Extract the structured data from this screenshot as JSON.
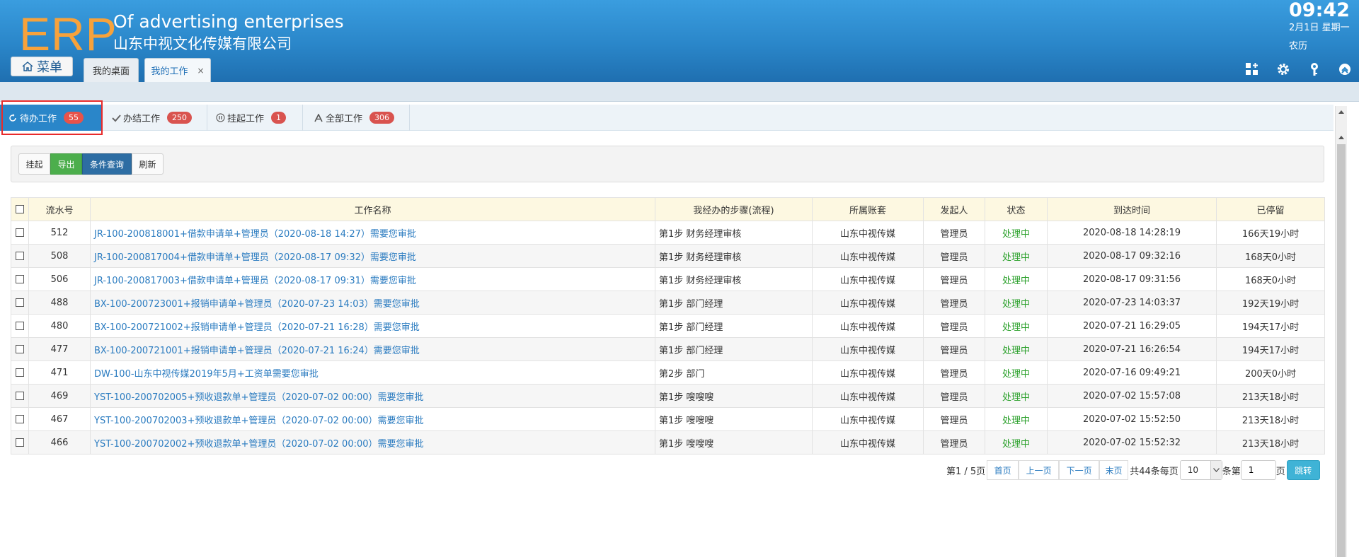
{
  "header": {
    "logo": "ERP",
    "company_en": "Of advertising enterprises",
    "company_cn": "山东中视文化传媒有限公司",
    "menu_label": "菜单",
    "tabs": [
      {
        "label": "我的桌面"
      },
      {
        "label": "我的工作",
        "close": "×"
      }
    ],
    "clock": "09:42",
    "date": "2月1日 星期一",
    "lunar": "农历",
    "icons": [
      "grid-add-icon",
      "gear-icon",
      "key-icon",
      "collapse-up-icon"
    ],
    "colors": {
      "brand_orange": "#f7a23b",
      "header_blue": "#2a86c9"
    }
  },
  "worktabs": [
    {
      "label": "待办工作",
      "count": "55",
      "icon": "refresh-icon"
    },
    {
      "label": "办结工作",
      "count": "250",
      "icon": "check-icon"
    },
    {
      "label": "挂起工作",
      "count": "1",
      "icon": "pause-icon"
    },
    {
      "label": "全部工作",
      "count": "306",
      "icon": "letter-a-icon"
    }
  ],
  "toolbar": {
    "hang": "挂起",
    "export": "导出",
    "query": "条件查询",
    "refresh": "刷新"
  },
  "table": {
    "columns": [
      "流水号",
      "工作名称",
      "我经办的步骤(流程)",
      "所属账套",
      "发起人",
      "状态",
      "到达时间",
      "已停留"
    ],
    "rows": [
      {
        "id": "512",
        "name": "JR-100-200818001+借款申请单+管理员（2020-08-18 14:27）需要您审批",
        "step": "第1步 财务经理审核",
        "account": "山东中视传媒",
        "initiator": "管理员",
        "status": "处理中",
        "arrive": "2020-08-18 14:28:19",
        "stay": "166天19小时"
      },
      {
        "id": "508",
        "name": "JR-100-200817004+借款申请单+管理员（2020-08-17 09:32）需要您审批",
        "step": "第1步 财务经理审核",
        "account": "山东中视传媒",
        "initiator": "管理员",
        "status": "处理中",
        "arrive": "2020-08-17 09:32:16",
        "stay": "168天0小时"
      },
      {
        "id": "506",
        "name": "JR-100-200817003+借款申请单+管理员（2020-08-17 09:31）需要您审批",
        "step": "第1步 财务经理审核",
        "account": "山东中视传媒",
        "initiator": "管理员",
        "status": "处理中",
        "arrive": "2020-08-17 09:31:56",
        "stay": "168天0小时"
      },
      {
        "id": "488",
        "name": "BX-100-200723001+报销申请单+管理员（2020-07-23 14:03）需要您审批",
        "step": "第1步 部门经理",
        "account": "山东中视传媒",
        "initiator": "管理员",
        "status": "处理中",
        "arrive": "2020-07-23 14:03:37",
        "stay": "192天19小时"
      },
      {
        "id": "480",
        "name": "BX-100-200721002+报销申请单+管理员（2020-07-21 16:28）需要您审批",
        "step": "第1步 部门经理",
        "account": "山东中视传媒",
        "initiator": "管理员",
        "status": "处理中",
        "arrive": "2020-07-21 16:29:05",
        "stay": "194天17小时"
      },
      {
        "id": "477",
        "name": "BX-100-200721001+报销申请单+管理员（2020-07-21 16:24）需要您审批",
        "step": "第1步 部门经理",
        "account": "山东中视传媒",
        "initiator": "管理员",
        "status": "处理中",
        "arrive": "2020-07-21 16:26:54",
        "stay": "194天17小时"
      },
      {
        "id": "471",
        "name": "DW-100-山东中视传媒2019年5月+工资单需要您审批",
        "step": "第2步 部门",
        "account": "山东中视传媒",
        "initiator": "管理员",
        "status": "处理中",
        "arrive": "2020-07-16 09:49:21",
        "stay": "200天0小时"
      },
      {
        "id": "469",
        "name": "YST-100-200702005+预收退款单+管理员（2020-07-02 00:00）需要您审批",
        "step": "第1步 嗖嗖嗖",
        "account": "山东中视传媒",
        "initiator": "管理员",
        "status": "处理中",
        "arrive": "2020-07-02 15:57:08",
        "stay": "213天18小时"
      },
      {
        "id": "467",
        "name": "YST-100-200702003+预收退款单+管理员（2020-07-02 00:00）需要您审批",
        "step": "第1步 嗖嗖嗖",
        "account": "山东中视传媒",
        "initiator": "管理员",
        "status": "处理中",
        "arrive": "2020-07-02 15:52:50",
        "stay": "213天18小时"
      },
      {
        "id": "466",
        "name": "YST-100-200702002+预收退款单+管理员（2020-07-02 00:00）需要您审批",
        "step": "第1步 嗖嗖嗖",
        "account": "山东中视传媒",
        "initiator": "管理员",
        "status": "处理中",
        "arrive": "2020-07-02 15:52:32",
        "stay": "213天18小时"
      }
    ]
  },
  "pager": {
    "page_info": "第1 / 5页",
    "first": "首页",
    "prev": "上一页",
    "next": "下一页",
    "last": "末页",
    "total": "共44条每页",
    "per_page": "10",
    "unit": "条第",
    "page_input": "1",
    "page_suffix": "页",
    "go": "跳转"
  }
}
